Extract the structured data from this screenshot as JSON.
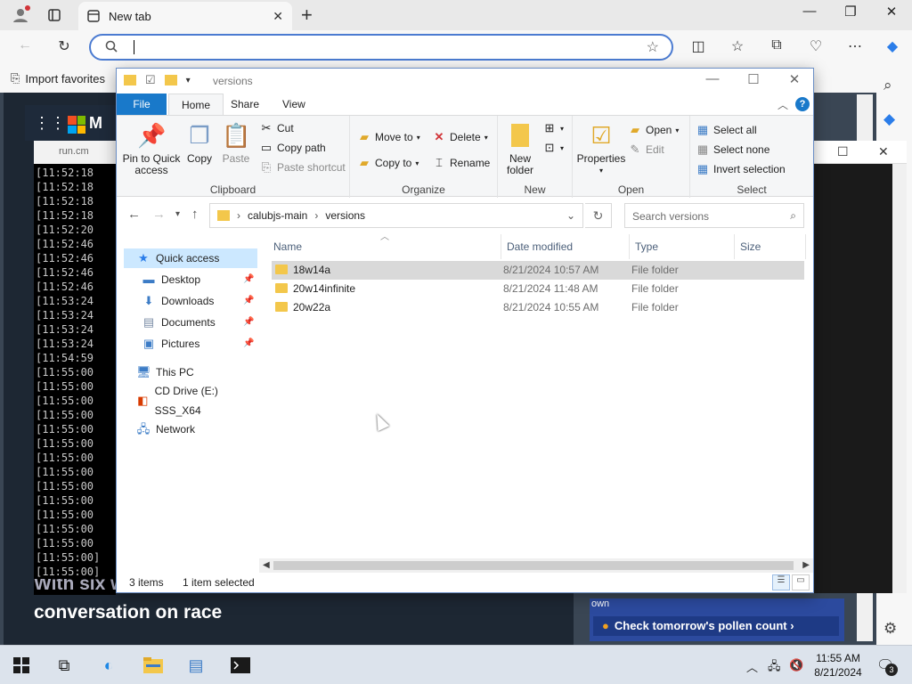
{
  "browser": {
    "tab_title": "New tab",
    "address_value": "",
    "favorites_import": "Import favorites"
  },
  "background": {
    "feed_logo_text": "M",
    "terminal_tab": "run.cm",
    "terminal_lines": [
      "[11:52:18",
      "[11:52:18",
      "[11:52:18",
      "[11:52:18",
      "[11:52:20",
      "[11:52:46",
      "[11:52:46",
      "[11:52:46",
      "[11:52:46",
      "[11:53:24",
      "[11:53:24",
      "[11:53:24",
      "[11:53:24",
      "[11:54:59",
      "[11:55:00",
      "[11:55:00",
      "[11:55:00",
      "[11:55:00",
      "[11:55:00",
      "[11:55:00",
      "[11:55:00",
      "[11:55:00",
      "[11:55:00",
      "[11:55:00",
      "[11:55:00",
      "[11:55:00",
      "[11:55:00",
      "[11:55:00]",
      "[11:55:00]"
    ],
    "news_headline_top": "With six words, Michelle Obama rewires America's",
    "news_headline": "conversation on race",
    "pollen_label": "Check tomorrow's pollen count ›",
    "pollen_tag": "own"
  },
  "explorer": {
    "title": "versions",
    "ribbon_tabs": {
      "file": "File",
      "home": "Home",
      "share": "Share",
      "view": "View"
    },
    "clipboard": {
      "pin": "Pin to Quick access",
      "copy": "Copy",
      "paste": "Paste",
      "cut": "Cut",
      "copy_path": "Copy path",
      "paste_shortcut": "Paste shortcut",
      "label": "Clipboard"
    },
    "organize": {
      "move_to": "Move to",
      "copy_to": "Copy to",
      "delete": "Delete",
      "rename": "Rename",
      "label": "Organize"
    },
    "new": {
      "new_folder": "New folder",
      "label": "New"
    },
    "open": {
      "properties": "Properties",
      "open": "Open",
      "edit": "Edit",
      "label": "Open"
    },
    "select": {
      "select_all": "Select all",
      "select_none": "Select none",
      "invert": "Invert selection",
      "label": "Select"
    },
    "path": [
      "calubjs-main",
      "versions"
    ],
    "search_placeholder": "Search versions",
    "nav": {
      "quick_access": "Quick access",
      "desktop": "Desktop",
      "downloads": "Downloads",
      "documents": "Documents",
      "pictures": "Pictures",
      "this_pc": "This PC",
      "cd_drive": "CD Drive (E:) SSS_X64",
      "network": "Network"
    },
    "columns": {
      "name": "Name",
      "date": "Date modified",
      "type": "Type",
      "size": "Size"
    },
    "files": [
      {
        "name": "18w14a",
        "date": "8/21/2024 10:57 AM",
        "type": "File folder",
        "selected": true
      },
      {
        "name": "20w14infinite",
        "date": "8/21/2024 11:48 AM",
        "type": "File folder",
        "selected": false
      },
      {
        "name": "20w22a",
        "date": "8/21/2024 10:55 AM",
        "type": "File folder",
        "selected": false
      }
    ],
    "status": {
      "items": "3 items",
      "selected": "1 item selected"
    }
  },
  "taskbar": {
    "time": "11:55 AM",
    "date": "8/21/2024",
    "notifications": "3"
  },
  "colors": {
    "accent": "#1979ca",
    "selection": "#cce8ff",
    "folder": "#f3c74b"
  }
}
